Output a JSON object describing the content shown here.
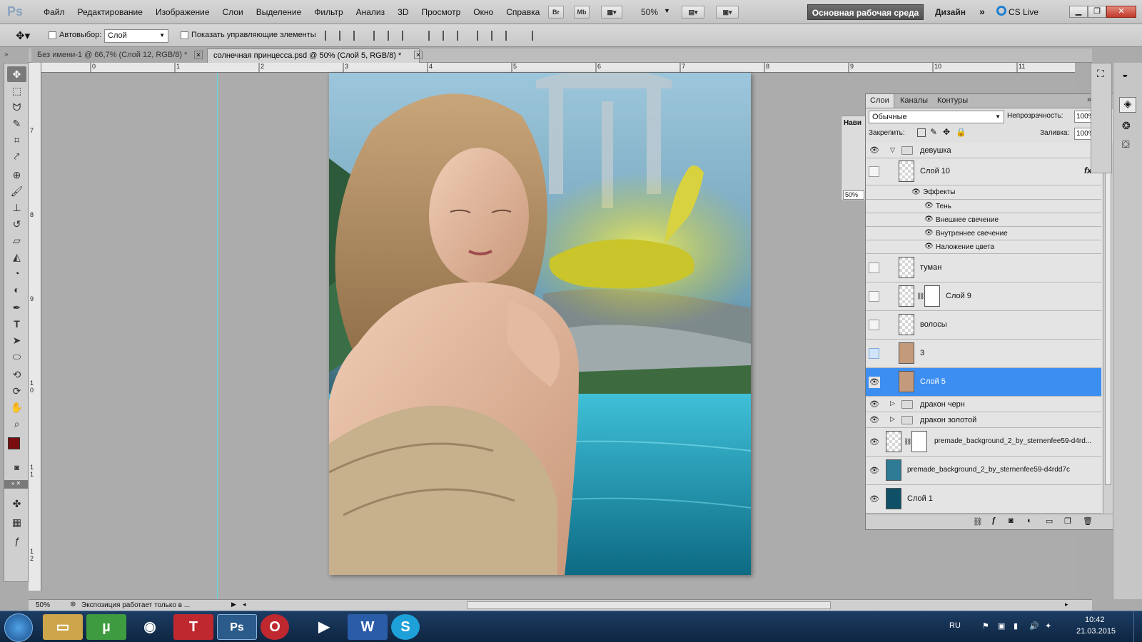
{
  "app": {
    "logo": "Ps"
  },
  "menu": [
    "Файл",
    "Редактирование",
    "Изображение",
    "Слои",
    "Выделение",
    "Фильтр",
    "Анализ",
    "3D",
    "Просмотр",
    "Окно",
    "Справка"
  ],
  "menubar": {
    "br": "Br",
    "mb": "Mb",
    "zoom": "50%",
    "workspace": "Основная рабочая среда",
    "design": "Дизайн",
    "cs_live": "CS Live"
  },
  "options": {
    "autoselect_label": "Автовыбор:",
    "autoselect_value": "Слой",
    "show_controls_label": "Показать управляющие элементы"
  },
  "tabs": [
    {
      "label": "Без имени-1 @ 66,7% (Слой 12, RGB/8) *"
    },
    {
      "label": "солнечная принцесса.psd @ 50% (Слой 5, RGB/8) *"
    }
  ],
  "ruler": {
    "h": [
      "0",
      "1",
      "2",
      "3",
      "4",
      "5",
      "6",
      "7",
      "8",
      "9",
      "10",
      "11"
    ],
    "v": [
      "7",
      "8",
      "9",
      "1 0",
      "1 1",
      "1 2"
    ]
  },
  "status": {
    "zoom": "50%",
    "text": "Экспозиция работает только в ..."
  },
  "navigator": {
    "title": "Нави",
    "zoom": "50%"
  },
  "layers_panel": {
    "tabs": [
      "Слои",
      "Каналы",
      "Контуры"
    ],
    "blend_mode": "Обычные",
    "opacity_label": "Непрозрачность:",
    "opacity": "100%",
    "lock_label": "Закрепить:",
    "fill_label": "Заливка:",
    "fill": "100%",
    "group_girl": "девушка",
    "layer10": "Слой 10",
    "fx_label": "fx",
    "effects_label": "Эффекты",
    "effects": [
      "Тень",
      "Внешнее свечение",
      "Внутреннее свечение",
      "Наложение цвета"
    ],
    "fog": "туман",
    "layer9": "Слой 9",
    "hair": "волосы",
    "three": "3",
    "layer5": "Слой 5",
    "group_black_dragon": "дракон черн",
    "group_gold_dragon": "дракон золотой",
    "premade1": "premade_background_2_by_sternenfee59-d4rd...",
    "premade2": "premade_background_2_by_sternenfee59-d4rdd7c",
    "layer1": "Слой 1"
  },
  "taskbar": {
    "lang": "RU",
    "time": "10:42",
    "date": "21.03.2015",
    "ps": "Ps",
    "word": "W",
    "t": "T"
  },
  "colors": {
    "accent_selection": "#3d8ef1",
    "foreground": "#7a0e0e",
    "background": "#000000",
    "guide": "#5fd8e0",
    "taskbar": "#102a48"
  }
}
